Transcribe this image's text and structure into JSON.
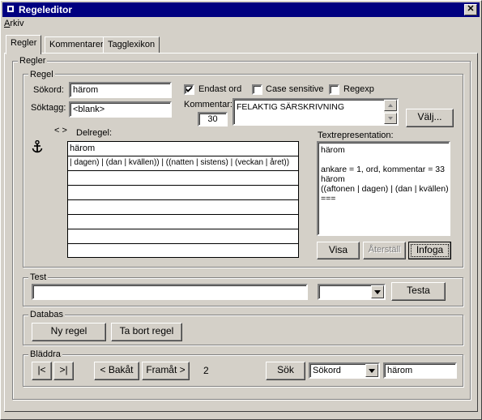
{
  "window": {
    "title": "Regeleditor",
    "close_glyph": "✕"
  },
  "menu": {
    "arkiv_first": "A",
    "arkiv_rest": "rkiv"
  },
  "tabs": [
    {
      "label": "Regler"
    },
    {
      "label": "Kommentarer"
    },
    {
      "label": "Tagglexikon"
    }
  ],
  "regler_group": {
    "label": "Regler"
  },
  "regel_group": {
    "label": "Regel",
    "sokord_label": "Sökord:",
    "sokord_value": "härom",
    "soktagg_label": "Söktagg:",
    "soktagg_value": "<blank>",
    "endast_ord_label": "Endast ord",
    "endast_ord_checked": true,
    "case_sensitive_label": "Case sensitive",
    "case_sensitive_checked": false,
    "regexp_label": "Regexp",
    "regexp_checked": false,
    "kommentar_label": "Kommentar:",
    "kommentar_number": "30",
    "kommentar_text": "FELAKTIG SÄRSKRIVNING",
    "valj_button": "Välj...",
    "anchor_icon": "anchor-icon",
    "arrows_text": "< >",
    "delregel_label": "Delregel:",
    "delregel_rows": [
      "härom",
      "| dagen) | (dan | kvällen)) | ((natten | sistens) | (veckan | året))",
      "",
      "",
      "",
      "",
      "",
      ""
    ],
    "textrep_label": "Textrepresentation:",
    "textrep_lines": [
      "härom",
      "",
      "ankare = 1, ord, kommentar = 33",
      "härom",
      "((aftonen | dagen) | (dan | kvällen)",
      "==="
    ],
    "visa_button": "Visa",
    "aterstall_button": "Återställ",
    "infoga_button": "Infoga"
  },
  "test_group": {
    "label": "Test",
    "input_value": "",
    "select_value": "",
    "testa_button": "Testa"
  },
  "databas_group": {
    "label": "Databas",
    "ny_regel_button": "Ny regel",
    "ta_bort_button": "Ta bort regel"
  },
  "bladdra_group": {
    "label": "Bläddra",
    "first_button": "|<",
    "last_button": ">|",
    "bakat_button": "< Bakåt",
    "framat_button": "Framåt >",
    "page_number": "2",
    "sok_button": "Sök",
    "field_select_value": "Sökord",
    "search_value": "härom"
  }
}
